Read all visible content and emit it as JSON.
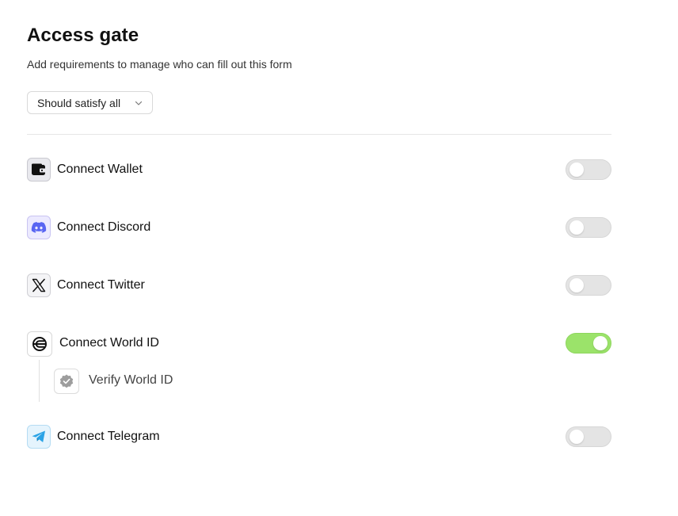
{
  "header": {
    "title": "Access gate",
    "subtitle": "Add requirements to manage who can fill out this form"
  },
  "condition_select": {
    "value": "Should satisfy all"
  },
  "requirements": [
    {
      "label": "Connect Wallet",
      "icon": "wallet-icon",
      "enabled": false
    },
    {
      "label": "Connect Discord",
      "icon": "discord-icon",
      "enabled": false
    },
    {
      "label": "Connect Twitter",
      "icon": "x-twitter-icon",
      "enabled": false
    },
    {
      "label": "Connect World ID",
      "icon": "world-id-icon",
      "enabled": true,
      "sub_items": [
        {
          "label": "Verify World ID",
          "icon": "verified-badge-icon"
        }
      ]
    },
    {
      "label": "Connect Telegram",
      "icon": "telegram-icon",
      "enabled": false
    }
  ],
  "colors": {
    "toggle_on": "#9be36a",
    "toggle_off": "#e4e4e4",
    "discord_bg": "#eceaff",
    "discord_accent": "#5865f2",
    "telegram_bg": "#e5f4fd",
    "telegram_accent": "#2aa3e6"
  }
}
